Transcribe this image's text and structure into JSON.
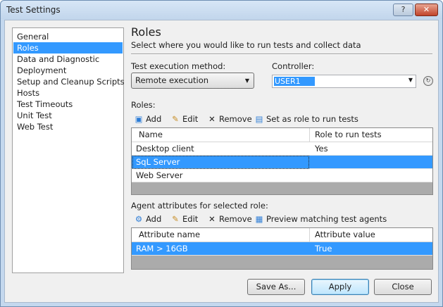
{
  "window": {
    "title": "Test Settings",
    "help_glyph": "?",
    "close_glyph": "✕"
  },
  "nav": {
    "items": [
      {
        "label": "General",
        "selected": false
      },
      {
        "label": "Roles",
        "selected": true
      },
      {
        "label": "Data and Diagnostic",
        "selected": false
      },
      {
        "label": "Deployment",
        "selected": false
      },
      {
        "label": "Setup and Cleanup Scripts",
        "selected": false
      },
      {
        "label": "Hosts",
        "selected": false
      },
      {
        "label": "Test Timeouts",
        "selected": false
      },
      {
        "label": "Unit Test",
        "selected": false
      },
      {
        "label": "Web Test",
        "selected": false
      }
    ]
  },
  "main": {
    "heading": "Roles",
    "subheading": "Select where you would like to run tests and collect data",
    "execution_method": {
      "label": "Test execution method:",
      "value": "Remote execution"
    },
    "controller": {
      "label": "Controller:",
      "value": "USER1"
    },
    "roles": {
      "label": "Roles:",
      "toolbar": {
        "add": "Add",
        "edit": "Edit",
        "remove": "Remove",
        "set_role": "Set as role to run tests"
      },
      "columns": [
        "Name",
        "Role to run tests"
      ],
      "rows": [
        [
          "Desktop client",
          "Yes"
        ],
        [
          "SqL Server",
          ""
        ],
        [
          "Web Server",
          ""
        ]
      ],
      "selected_row": 1
    },
    "attributes": {
      "label": "Agent attributes for selected role:",
      "toolbar": {
        "add": "Add",
        "edit": "Edit",
        "remove": "Remove",
        "preview": "Preview matching test agents"
      },
      "columns": [
        "Attribute name",
        "Attribute value"
      ],
      "rows": [
        [
          "RAM > 16GB",
          "True"
        ]
      ],
      "selected_row": 0
    }
  },
  "buttons": {
    "save_as": "Save As...",
    "apply": "Apply",
    "close": "Close"
  },
  "icons": {
    "add": "add-icon",
    "edit": "pencil-icon",
    "remove": "x-icon",
    "set_role": "set-role-icon",
    "attr_add": "attribute-add-icon",
    "preview": "preview-agents-icon",
    "refresh": "refresh-icon"
  },
  "colors": {
    "selection": "#3399ff",
    "title_bar": "#c2d6ec",
    "close_button": "#c1442a"
  }
}
